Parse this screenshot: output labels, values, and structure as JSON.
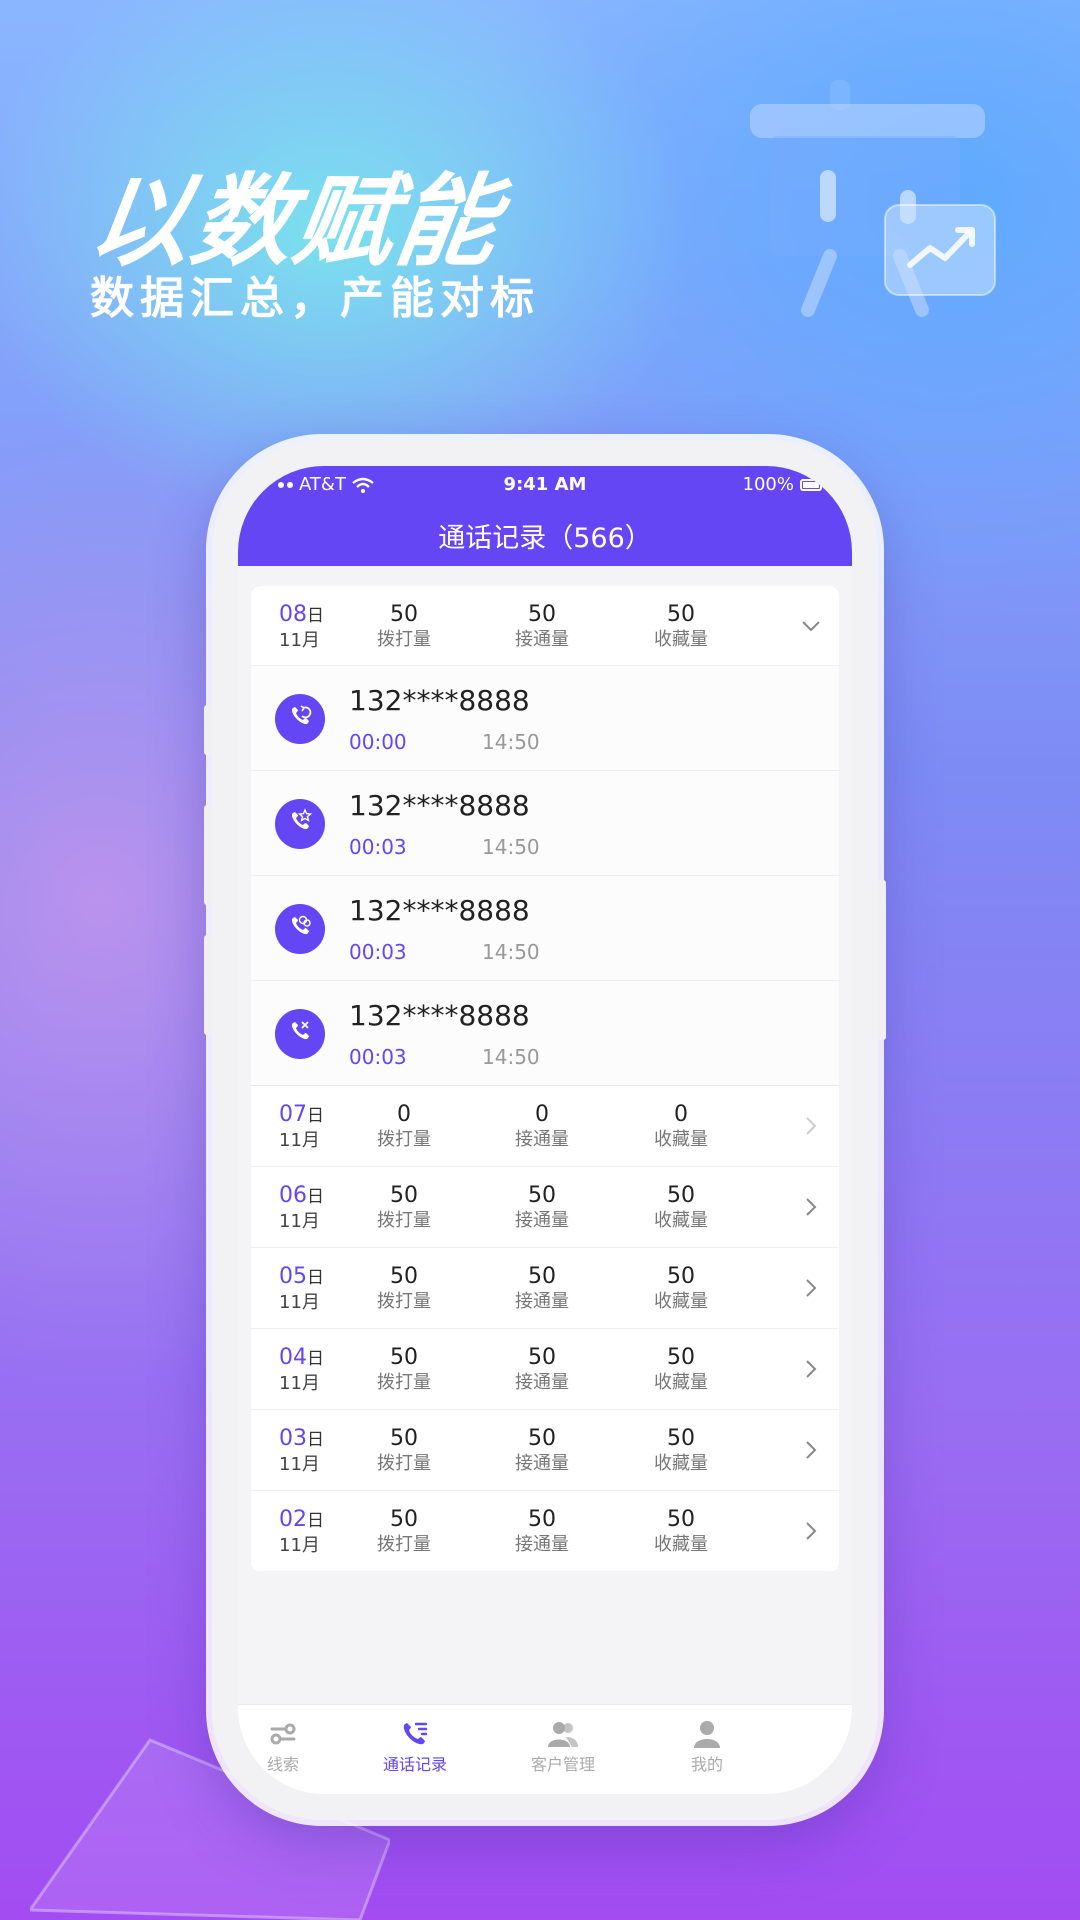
{
  "hero": {
    "title": "以数赋能",
    "subtitle": "数据汇总，产能对标"
  },
  "status_bar": {
    "carrier": "AT&T",
    "time": "9:41 AM",
    "battery": "100%"
  },
  "header": {
    "title": "通话记录（566）"
  },
  "labels": {
    "day_suffix": "日",
    "dialed": "拨打量",
    "connected": "接通量",
    "favorited": "收藏量"
  },
  "days": [
    {
      "day": "08",
      "month": "11月",
      "dialed": "50",
      "connected": "50",
      "favorited": "50",
      "expanded": true
    },
    {
      "day": "07",
      "month": "11月",
      "dialed": "0",
      "connected": "0",
      "favorited": "0"
    },
    {
      "day": "06",
      "month": "11月",
      "dialed": "50",
      "connected": "50",
      "favorited": "50"
    },
    {
      "day": "05",
      "month": "11月",
      "dialed": "50",
      "connected": "50",
      "favorited": "50"
    },
    {
      "day": "04",
      "month": "11月",
      "dialed": "50",
      "connected": "50",
      "favorited": "50"
    },
    {
      "day": "03",
      "month": "11月",
      "dialed": "50",
      "connected": "50",
      "favorited": "50"
    },
    {
      "day": "02",
      "month": "11月",
      "dialed": "50",
      "connected": "50",
      "favorited": "50"
    }
  ],
  "calls": [
    {
      "number": "132****8888",
      "duration": "00:00",
      "time": "14:50",
      "icon": "phone-redial-icon"
    },
    {
      "number": "132****8888",
      "duration": "00:03",
      "time": "14:50",
      "icon": "phone-star-icon"
    },
    {
      "number": "132****8888",
      "duration": "00:03",
      "time": "14:50",
      "icon": "phone-chat-icon"
    },
    {
      "number": "132****8888",
      "duration": "00:03",
      "time": "14:50",
      "icon": "phone-missed-icon"
    }
  ],
  "tabs": [
    {
      "label": "线索",
      "icon": "clues-icon"
    },
    {
      "label": "通话记录",
      "icon": "call-log-icon",
      "active": true
    },
    {
      "label": "客户管理",
      "icon": "customers-icon"
    },
    {
      "label": "我的",
      "icon": "profile-icon"
    }
  ],
  "colors": {
    "accent": "#6446f5"
  }
}
